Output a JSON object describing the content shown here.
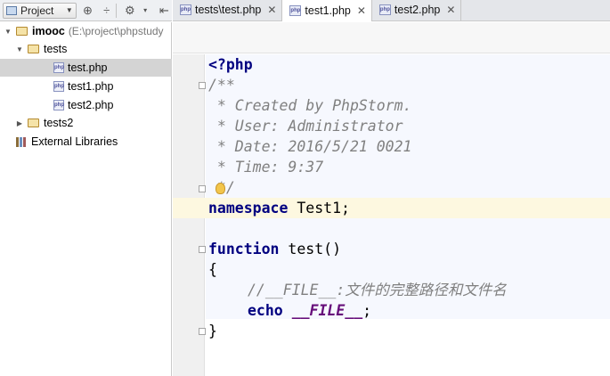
{
  "project_toolbar": {
    "view_label": "Project",
    "icons": [
      "sync-icon",
      "collapse-icon",
      "gear-icon",
      "hide-panel-icon"
    ]
  },
  "tabs": [
    {
      "label": "tests\\test.php",
      "active": false
    },
    {
      "label": "test1.php",
      "active": true
    },
    {
      "label": "test2.php",
      "active": false
    }
  ],
  "tree": {
    "root": {
      "name": "imooc",
      "path": "(E:\\project\\phpstudy"
    },
    "tests_folder": "tests",
    "files": [
      "test.php",
      "test1.php",
      "test2.php"
    ],
    "selected": "test.php",
    "tests2_folder": "tests2",
    "external": "External Libraries"
  },
  "code": {
    "open_tag": "<?php",
    "doc_open": "/**",
    "doc_lines": [
      " * Created by PhpStorm.",
      " * User: Administrator",
      " * Date: 2016/5/21 0021",
      " * Time: 9:37"
    ],
    "doc_close": " */",
    "namespace_kw": "namespace",
    "namespace_rest": " Test1;",
    "function_kw": "function",
    "function_rest": " test()",
    "brace_open": "{",
    "comment": "//__FILE__:文件的完整路径和文件名",
    "echo_kw": "echo",
    "magic_const": "__FILE__",
    "semicolon": ";",
    "brace_close": "}"
  },
  "colors": {
    "keyword": "#000080",
    "comment": "#808080",
    "magic": "#660e7a",
    "selection": "#d4d4d4",
    "caret_line": "#fdf8e0"
  }
}
